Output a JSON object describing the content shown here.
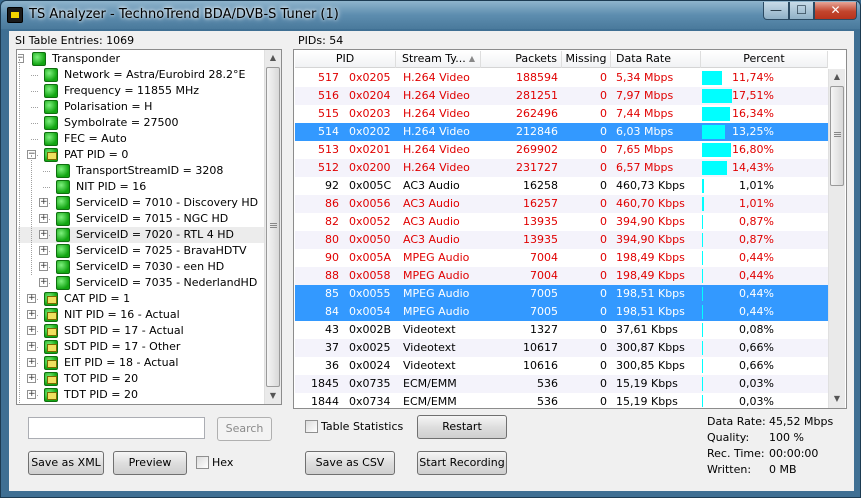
{
  "window": {
    "title": "TS Analyzer - TechnoTrend BDA/DVB-S Tuner (1)"
  },
  "si_panel": {
    "header": "SI Table Entries: 1069",
    "tree": [
      {
        "label": "Transponder",
        "level": 0,
        "expander": "minus",
        "icon": "green-node-icon"
      },
      {
        "label": "Network = Astra/Eurobird 28.2°E",
        "level": 1,
        "expander": "",
        "icon": "green-node-icon"
      },
      {
        "label": "Frequency = 11855 MHz",
        "level": 1,
        "expander": "",
        "icon": "green-node-icon"
      },
      {
        "label": "Polarisation = H",
        "level": 1,
        "expander": "",
        "icon": "green-node-icon"
      },
      {
        "label": "Symbolrate = 27500",
        "level": 1,
        "expander": "",
        "icon": "green-node-icon"
      },
      {
        "label": "FEC = Auto",
        "level": 1,
        "expander": "",
        "icon": "green-node-icon"
      },
      {
        "label": "PAT PID = 0",
        "level": 1,
        "expander": "minus",
        "icon": "table-node-icon"
      },
      {
        "label": "TransportStreamID = 3208",
        "level": 2,
        "expander": "",
        "icon": "green-node-icon"
      },
      {
        "label": "NIT PID = 16",
        "level": 2,
        "expander": "",
        "icon": "green-node-icon"
      },
      {
        "label": "ServiceID = 7010 - Discovery HD",
        "level": 2,
        "expander": "plus",
        "icon": "green-node-icon"
      },
      {
        "label": "ServiceID = 7015 - NGC HD",
        "level": 2,
        "expander": "plus",
        "icon": "green-node-icon"
      },
      {
        "label": "ServiceID = 7020 - RTL 4 HD",
        "level": 2,
        "expander": "plus",
        "icon": "green-node-icon"
      },
      {
        "label": "ServiceID = 7025 - BravaHDTV",
        "level": 2,
        "expander": "plus",
        "icon": "green-node-icon"
      },
      {
        "label": "ServiceID = 7030 - een HD",
        "level": 2,
        "expander": "plus",
        "icon": "green-node-icon"
      },
      {
        "label": "ServiceID = 7035 - NederlandHD",
        "level": 2,
        "expander": "plus",
        "icon": "green-node-icon"
      },
      {
        "label": "CAT PID = 1",
        "level": 1,
        "expander": "plus",
        "icon": "table-node-icon"
      },
      {
        "label": "NIT PID = 16 - Actual",
        "level": 1,
        "expander": "plus",
        "icon": "table-node-icon"
      },
      {
        "label": "SDT PID = 17 - Actual",
        "level": 1,
        "expander": "plus",
        "icon": "table-node-icon"
      },
      {
        "label": "SDT PID = 17 - Other",
        "level": 1,
        "expander": "plus",
        "icon": "table-node-icon"
      },
      {
        "label": "EIT PID = 18 - Actual",
        "level": 1,
        "expander": "plus",
        "icon": "table-node-icon"
      },
      {
        "label": "TOT PID = 20",
        "level": 1,
        "expander": "plus",
        "icon": "table-node-icon"
      },
      {
        "label": "TDT PID = 20",
        "level": 1,
        "expander": "plus",
        "icon": "table-node-icon"
      }
    ],
    "selected_row": 11,
    "search_value": "",
    "search_button": "Search",
    "save_xml_button": "Save as XML",
    "preview_button": "Preview",
    "hex_label": "Hex"
  },
  "pid_panel": {
    "header": "PIDs: 54",
    "columns": [
      "PID",
      "Stream Ty...",
      "Packets",
      "Missing",
      "Data Rate",
      "Percent"
    ],
    "rows": [
      {
        "pid": "517",
        "hex": "0x0205",
        "type": "H.264 Video",
        "packets": "188594",
        "missing": "0",
        "rate": "5,34 Mbps",
        "percent": "11,74%",
        "pct": 11.74,
        "red": true,
        "sel": false
      },
      {
        "pid": "516",
        "hex": "0x0204",
        "type": "H.264 Video",
        "packets": "281251",
        "missing": "0",
        "rate": "7,97 Mbps",
        "percent": "17,51%",
        "pct": 17.51,
        "red": true,
        "sel": false
      },
      {
        "pid": "515",
        "hex": "0x0203",
        "type": "H.264 Video",
        "packets": "262496",
        "missing": "0",
        "rate": "7,44 Mbps",
        "percent": "16,34%",
        "pct": 16.34,
        "red": true,
        "sel": false
      },
      {
        "pid": "514",
        "hex": "0x0202",
        "type": "H.264 Video",
        "packets": "212846",
        "missing": "0",
        "rate": "6,03 Mbps",
        "percent": "13,25%",
        "pct": 13.25,
        "red": true,
        "sel": true
      },
      {
        "pid": "513",
        "hex": "0x0201",
        "type": "H.264 Video",
        "packets": "269902",
        "missing": "0",
        "rate": "7,65 Mbps",
        "percent": "16,80%",
        "pct": 16.8,
        "red": true,
        "sel": false
      },
      {
        "pid": "512",
        "hex": "0x0200",
        "type": "H.264 Video",
        "packets": "231727",
        "missing": "0",
        "rate": "6,57 Mbps",
        "percent": "14,43%",
        "pct": 14.43,
        "red": true,
        "sel": false
      },
      {
        "pid": "92",
        "hex": "0x005C",
        "type": "AC3 Audio",
        "packets": "16258",
        "missing": "0",
        "rate": "460,73 Kbps",
        "percent": "1,01%",
        "pct": 1.01,
        "red": false,
        "sel": false
      },
      {
        "pid": "86",
        "hex": "0x0056",
        "type": "AC3 Audio",
        "packets": "16257",
        "missing": "0",
        "rate": "460,70 Kbps",
        "percent": "1,01%",
        "pct": 1.01,
        "red": true,
        "sel": false
      },
      {
        "pid": "82",
        "hex": "0x0052",
        "type": "AC3 Audio",
        "packets": "13935",
        "missing": "0",
        "rate": "394,90 Kbps",
        "percent": "0,87%",
        "pct": 0.87,
        "red": true,
        "sel": false
      },
      {
        "pid": "80",
        "hex": "0x0050",
        "type": "AC3 Audio",
        "packets": "13935",
        "missing": "0",
        "rate": "394,90 Kbps",
        "percent": "0,87%",
        "pct": 0.87,
        "red": true,
        "sel": false
      },
      {
        "pid": "90",
        "hex": "0x005A",
        "type": "MPEG Audio",
        "packets": "7004",
        "missing": "0",
        "rate": "198,49 Kbps",
        "percent": "0,44%",
        "pct": 0.44,
        "red": true,
        "sel": false
      },
      {
        "pid": "88",
        "hex": "0x0058",
        "type": "MPEG Audio",
        "packets": "7004",
        "missing": "0",
        "rate": "198,49 Kbps",
        "percent": "0,44%",
        "pct": 0.44,
        "red": true,
        "sel": false
      },
      {
        "pid": "85",
        "hex": "0x0055",
        "type": "MPEG Audio",
        "packets": "7005",
        "missing": "0",
        "rate": "198,51 Kbps",
        "percent": "0,44%",
        "pct": 0.44,
        "red": true,
        "sel": true
      },
      {
        "pid": "84",
        "hex": "0x0054",
        "type": "MPEG Audio",
        "packets": "7005",
        "missing": "0",
        "rate": "198,51 Kbps",
        "percent": "0,44%",
        "pct": 0.44,
        "red": true,
        "sel": true
      },
      {
        "pid": "43",
        "hex": "0x002B",
        "type": "Videotext",
        "packets": "1327",
        "missing": "0",
        "rate": "37,61 Kbps",
        "percent": "0,08%",
        "pct": 0.08,
        "red": false,
        "sel": false
      },
      {
        "pid": "37",
        "hex": "0x0025",
        "type": "Videotext",
        "packets": "10617",
        "missing": "0",
        "rate": "300,87 Kbps",
        "percent": "0,66%",
        "pct": 0.66,
        "red": false,
        "sel": false
      },
      {
        "pid": "36",
        "hex": "0x0024",
        "type": "Videotext",
        "packets": "10616",
        "missing": "0",
        "rate": "300,85 Kbps",
        "percent": "0,66%",
        "pct": 0.66,
        "red": false,
        "sel": false
      },
      {
        "pid": "1845",
        "hex": "0x0735",
        "type": "ECM/EMM",
        "packets": "536",
        "missing": "0",
        "rate": "15,19 Kbps",
        "percent": "0,03%",
        "pct": 0.03,
        "red": false,
        "sel": false
      },
      {
        "pid": "1844",
        "hex": "0x0734",
        "type": "ECM/EMM",
        "packets": "536",
        "missing": "0",
        "rate": "15,19 Kbps",
        "percent": "0,03%",
        "pct": 0.03,
        "red": false,
        "sel": false
      }
    ],
    "table_statistics_label": "Table Statistics",
    "restart_button": "Restart",
    "save_csv_button": "Save as CSV",
    "start_recording_button": "Start Recording"
  },
  "stats": {
    "data_rate_label": "Data Rate:",
    "data_rate_value": "45,52 Mbps",
    "quality_label": "Quality:",
    "quality_value": "100 %",
    "rec_time_label": "Rec. Time:",
    "rec_time_value": "00:00:00",
    "written_label": "Written:",
    "written_value": "0 MB"
  },
  "colors": {
    "selection": "#3399ff",
    "bar": "#00ffff",
    "red_text": "#e00000"
  }
}
